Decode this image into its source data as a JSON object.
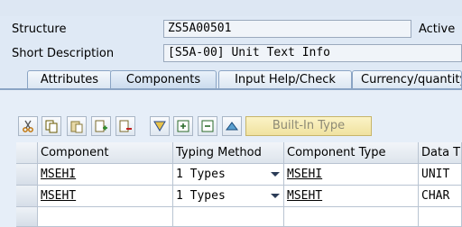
{
  "header": {
    "structure_label": "Structure",
    "structure_value": "ZS5A00501",
    "status": "Active",
    "short_desc_label": "Short Description",
    "short_desc_value": "[S5A-00] Unit Text Info"
  },
  "tabs": [
    {
      "label": "Attributes"
    },
    {
      "label": "Components",
      "active": true
    },
    {
      "label": "Input Help/Check"
    },
    {
      "label": "Currency/quantity"
    }
  ],
  "toolbar": {
    "icons": [
      "cut-icon",
      "copy-icon",
      "paste-icon",
      "insert-row-icon",
      "delete-row-icon",
      "filter-icon",
      "expand-icon",
      "collapse-icon",
      "move-up-icon"
    ],
    "builtin_label": "Built-In Type"
  },
  "table": {
    "headers": [
      "Component",
      "Typing Method",
      "Component Type",
      "Data T"
    ],
    "rows": [
      {
        "component": "MSEHI",
        "typing": "1 Types",
        "ctype": "MSEHI",
        "dtype": "UNIT"
      },
      {
        "component": "MSEHT",
        "typing": "1 Types",
        "ctype": "MSEHT",
        "dtype": "CHAR"
      }
    ]
  },
  "colors": {
    "accent": "#8aa4c4",
    "button_builtin": "#f0e2a0"
  }
}
